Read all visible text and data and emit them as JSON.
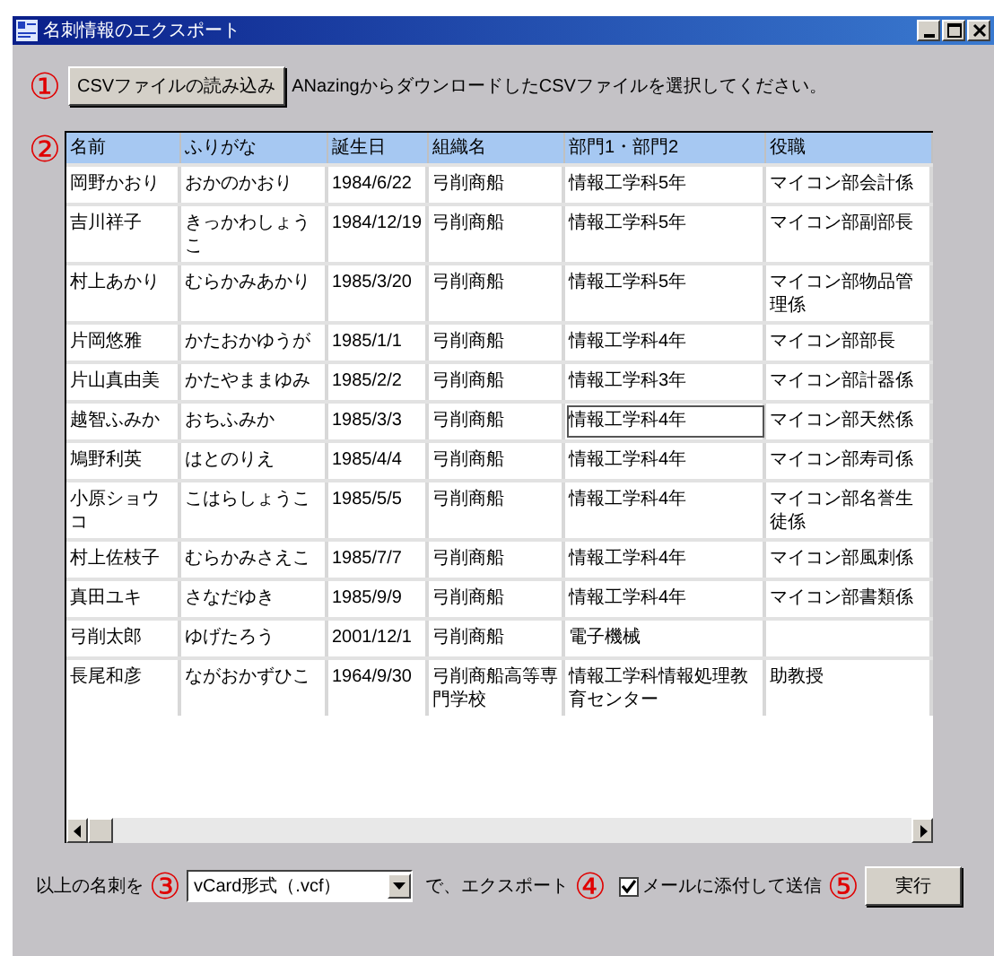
{
  "window": {
    "title": "名刺情報のエクスポート"
  },
  "load_button": "CSVファイルの読み込み",
  "instruction": "ANazingからダウンロードしたCSVファイルを選択してください。",
  "table": {
    "columns": [
      "名前",
      "ふりがな",
      "誕生日",
      "組織名",
      "部門1・部門2",
      "役職"
    ],
    "rows": [
      {
        "cells": [
          "岡野かおり",
          "おかのかおり",
          "1984/6/22",
          "弓削商船",
          "情報工学科5年",
          "マイコン部会計係"
        ],
        "focused": false
      },
      {
        "cells": [
          "吉川祥子",
          "きっかわしょうこ",
          "1984/12/19",
          "弓削商船",
          "情報工学科5年",
          "マイコン部副部長"
        ],
        "focused": false
      },
      {
        "cells": [
          "村上あかり",
          "むらかみあかり",
          "1985/3/20",
          "弓削商船",
          "情報工学科5年",
          "マイコン部物品管理係"
        ],
        "focused": false
      },
      {
        "cells": [
          "片岡悠雅",
          "かたおかゆうが",
          "1985/1/1",
          "弓削商船",
          "情報工学科4年",
          "マイコン部部長"
        ],
        "focused": false
      },
      {
        "cells": [
          "片山真由美",
          "かたやままゆみ",
          "1985/2/2",
          "弓削商船",
          "情報工学科3年",
          "マイコン部計器係"
        ],
        "focused": false
      },
      {
        "cells": [
          "越智ふみか",
          "おちふみか",
          "1985/3/3",
          "弓削商船",
          "情報工学科4年",
          "マイコン部天然係"
        ],
        "focused": true
      },
      {
        "cells": [
          "鳩野利英",
          "はとのりえ",
          "1985/4/4",
          "弓削商船",
          "情報工学科4年",
          "マイコン部寿司係"
        ],
        "focused": false
      },
      {
        "cells": [
          "小原ショウコ",
          "こはらしょうこ",
          "1985/5/5",
          "弓削商船",
          "情報工学科4年",
          "マイコン部名誉生徒係"
        ],
        "focused": false
      },
      {
        "cells": [
          "村上佐枝子",
          "むらかみさえこ",
          "1985/7/7",
          "弓削商船",
          "情報工学科4年",
          "マイコン部風刺係"
        ],
        "focused": false
      },
      {
        "cells": [
          "真田ユキ",
          "さなだゆき",
          "1985/9/9",
          "弓削商船",
          "情報工学科4年",
          "マイコン部書類係"
        ],
        "focused": false
      },
      {
        "cells": [
          "弓削太郎",
          "ゆげたろう",
          "2001/12/1",
          "弓削商船",
          "電子機械",
          ""
        ],
        "focused": false
      },
      {
        "cells": [
          "長尾和彦",
          "ながおかずひこ",
          "1964/9/30",
          "弓削商船高等専門学校",
          "情報工学科情報処理教育センター",
          "助教授"
        ],
        "focused": false
      }
    ]
  },
  "export_label": "以上の名刺を",
  "format_select": {
    "value": "vCard形式（.vcf）"
  },
  "export_suffix": "で、エクスポート",
  "mail_checkbox": {
    "label": "メールに添付して送信",
    "checked": true
  },
  "run_button": "実行",
  "annotations": [
    "①",
    "②",
    "③",
    "④",
    "⑤"
  ]
}
